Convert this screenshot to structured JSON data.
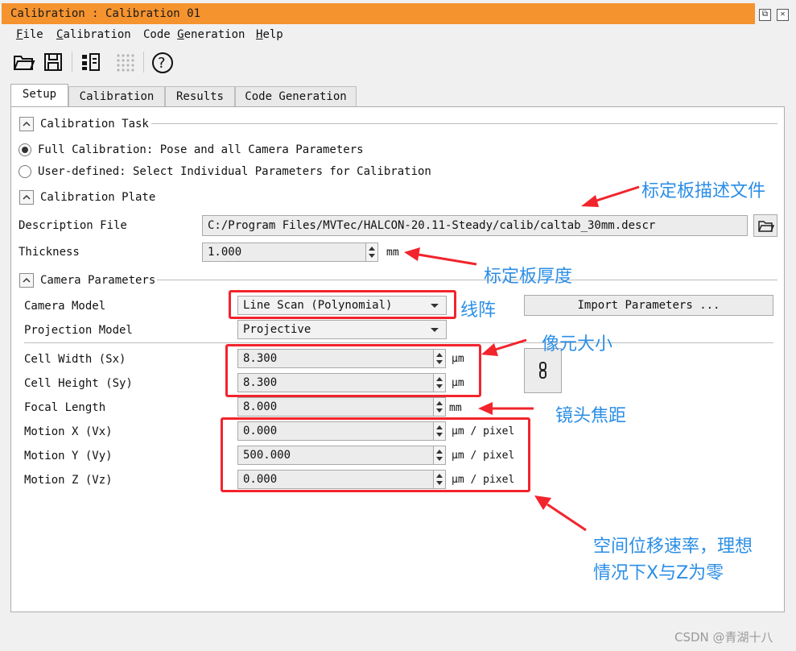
{
  "window": {
    "title": "Calibration : Calibration 01"
  },
  "menu": [
    {
      "label": "File",
      "mnemonic": "F",
      "rest": "ile"
    },
    {
      "label": "Calibration",
      "mnemonic": "C",
      "rest": "alibration"
    },
    {
      "label": "Code Generation",
      "mnemonic": "Code ",
      "u": "G",
      "rest2": "eneration"
    },
    {
      "label": "Help",
      "mnemonic": "H",
      "rest": "elp"
    }
  ],
  "menu_text": {
    "file_u": "F",
    "file_r": "ile",
    "calib_u": "C",
    "calib_r": "alibration",
    "code_a": "Code ",
    "code_u": "G",
    "code_r": "eneration",
    "help_u": "H",
    "help_r": "elp"
  },
  "toolbar": {
    "icons": [
      "open-folder-icon",
      "save-icon",
      "code-export-icon",
      "grid-dots-icon",
      "help-icon"
    ],
    "help_glyph": "?"
  },
  "tabs": [
    "Setup",
    "Calibration",
    "Results",
    "Code Generation"
  ],
  "sections": {
    "task": "Calibration Task",
    "plate": "Calibration Plate",
    "camera": "Camera Parameters"
  },
  "task": {
    "full": "Full Calibration: Pose and all Camera Parameters",
    "user": "User-defined: Select Individual Parameters for Calibration",
    "selected": "full"
  },
  "plate": {
    "description_label": "Description File",
    "description_value": "C:/Program Files/MVTec/HALCON-20.11-Steady/calib/caltab_30mm.descr",
    "thickness_label": "Thickness",
    "thickness_value": "1.000",
    "thickness_unit": "mm"
  },
  "camera": {
    "model_label": "Camera Model",
    "model_value": "Line Scan (Polynomial)",
    "import_button": "Import Parameters ...",
    "projection_label": "Projection Model",
    "projection_value": "Projective",
    "cell_width_label": "Cell Width (Sx)",
    "cell_width_value": "8.300",
    "cell_height_label": "Cell Height (Sy)",
    "cell_height_value": "8.300",
    "cell_unit": "μm",
    "focal_label": "Focal Length",
    "focal_value": "8.000",
    "focal_unit": "mm",
    "motion_x_label": "Motion X (Vx)",
    "motion_x_value": "0.000",
    "motion_y_label": "Motion Y (Vy)",
    "motion_y_value": "500.000",
    "motion_z_label": "Motion Z (Vz)",
    "motion_z_value": "0.000",
    "motion_unit": "μm / pixel"
  },
  "annotations": {
    "description_file": "标定板描述文件",
    "thickness": "标定板厚度",
    "line_scan": "线阵",
    "pixel_size": "像元大小",
    "focal_length": "镜头焦距",
    "motion_line1": "空间位移速率，理想",
    "motion_line2": "情况下X与Z为零",
    "accent": "#f2242c",
    "text_color": "#2b8ee6"
  },
  "watermark": "CSDN @青湖十八"
}
